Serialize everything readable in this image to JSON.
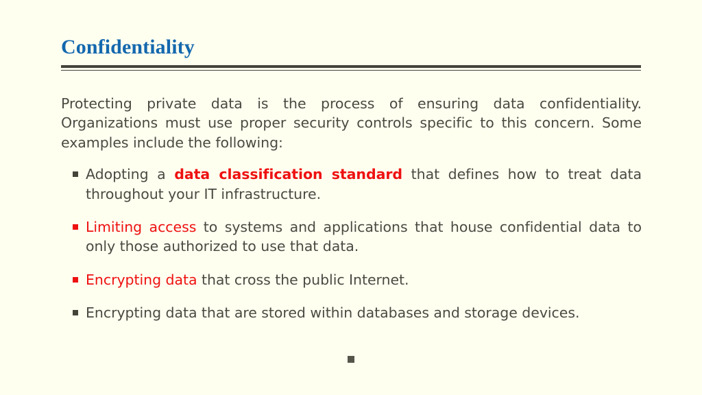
{
  "slide": {
    "title": "Confidentiality",
    "background_color": "#fffff0",
    "title_color": "#1468ae",
    "rule_color": "#44443a",
    "body_color": "#4a4a42",
    "accent_color": "#ee1111"
  },
  "intro": {
    "text": "Protecting private data is the process of ensuring data confidentiality. Organizations must use proper security controls specific to this concern.  Some examples include the following:"
  },
  "bullets": [
    {
      "marker_color": "#44443a",
      "lead": "Adopting a ",
      "highlight": "data classification standard",
      "highlight_style": "red-bold",
      "tail": " that defines how to treat data throughout your IT infrastructure."
    },
    {
      "marker_color": "#ee1111",
      "lead": "",
      "highlight": "Limiting access",
      "highlight_style": "red",
      "tail": " to systems and applications that house confidential data to only those authorized to use that data."
    },
    {
      "marker_color": "#ee1111",
      "lead": "",
      "highlight": "Encrypting data",
      "highlight_style": "red",
      "tail": " that cross the public Internet."
    },
    {
      "marker_color": "#44443a",
      "lead": "",
      "highlight": "",
      "highlight_style": "none",
      "tail": "Encrypting data that are stored within databases and storage devices."
    }
  ],
  "trailing_bullet": {
    "marker_color": "#55554a",
    "text": ""
  }
}
